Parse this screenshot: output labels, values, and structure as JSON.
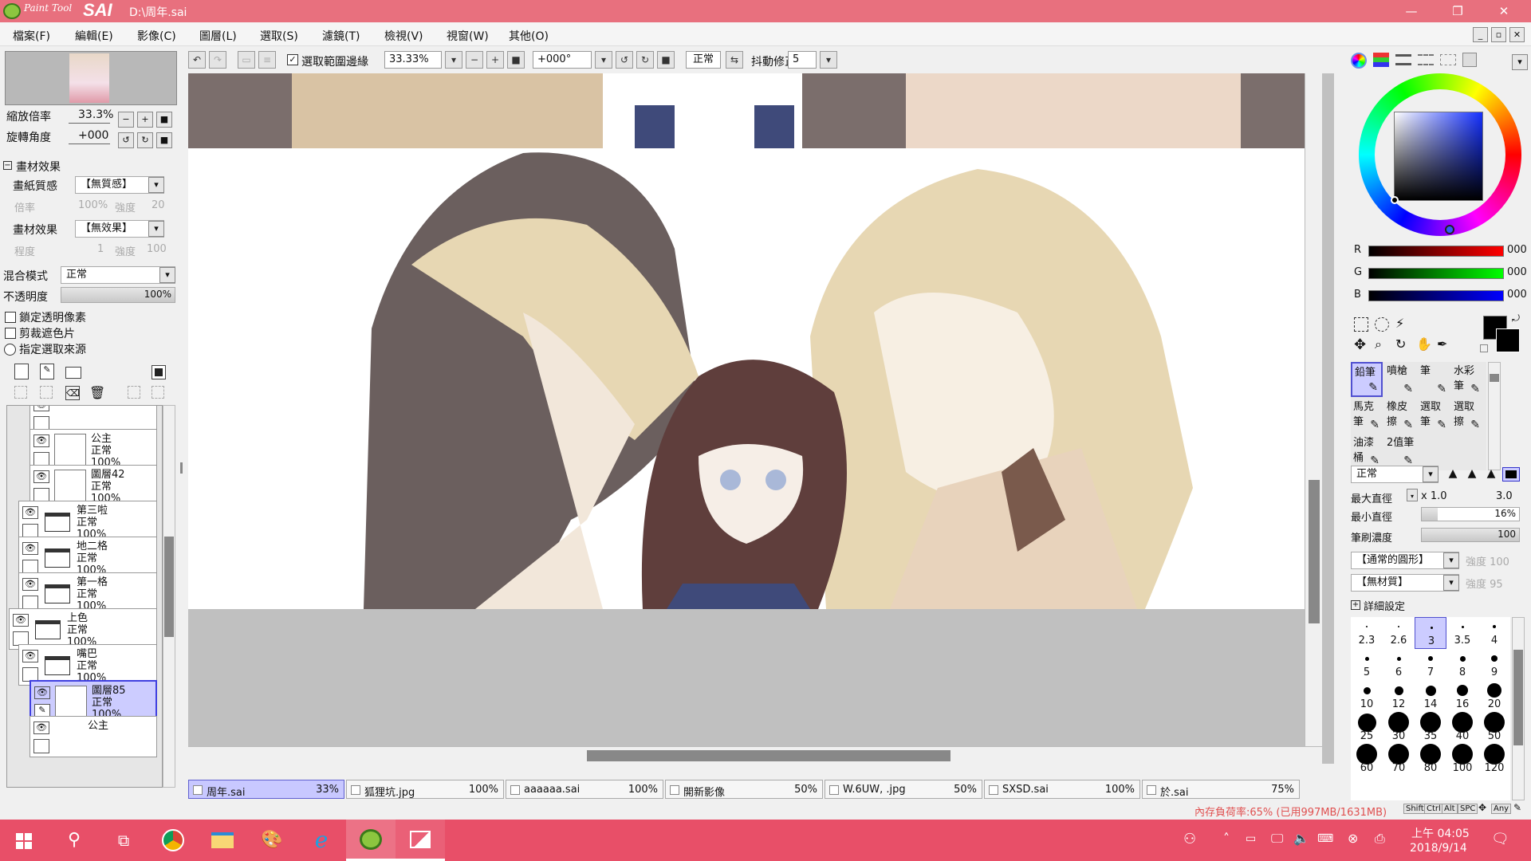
{
  "window": {
    "app_name_small": "Paint Tool",
    "app_name_big": "SAI",
    "title": "D:\\周年.sai"
  },
  "menu": [
    "檔案(F)",
    "編輯(E)",
    "影像(C)",
    "圖層(L)",
    "選取(S)",
    "濾鏡(T)",
    "檢視(V)",
    "視窗(W)",
    "其他(O)"
  ],
  "toolbar": {
    "select_edge_label": "選取範圍邊緣",
    "zoom_value": "33.33%",
    "rotation_value": "+000°",
    "mode_value": "正常",
    "stabilizer_label": "抖動修正",
    "stabilizer_value": "5"
  },
  "navigator": {
    "zoom_label": "縮放倍率",
    "zoom_value": "33.3%",
    "rotate_label": "旋轉角度",
    "rotate_value": "+000"
  },
  "paper": {
    "section": "畫材效果",
    "texture_label": "畫紙質感",
    "texture_value": "【無質感】",
    "tex_scale_label": "倍率",
    "tex_scale_value": "100%",
    "tex_strength_label": "強度",
    "tex_strength_value": "20",
    "effect_label": "畫材效果",
    "effect_value": "【無效果】",
    "eff_degree_label": "程度",
    "eff_degree_value": "1",
    "eff_strength_label": "強度",
    "eff_strength_value": "100"
  },
  "layer_props": {
    "blend_label": "混合模式",
    "blend_value": "正常",
    "opacity_label": "不透明度",
    "opacity_value": "100%",
    "opacity_level": 1.0,
    "lock_label": "鎖定透明像素",
    "clip_label": "剪裁遮色片",
    "source_label": "指定選取來源"
  },
  "layers": [
    {
      "name": "",
      "mode": "",
      "opacity": "100%",
      "type": "partial"
    },
    {
      "name": "公主",
      "mode": "正常",
      "opacity": "100%",
      "type": "layer"
    },
    {
      "name": "圖層42",
      "mode": "正常",
      "opacity": "100%",
      "type": "layer"
    },
    {
      "name": "第三啦",
      "mode": "正常",
      "opacity": "100%",
      "type": "folder"
    },
    {
      "name": "地二格",
      "mode": "正常",
      "opacity": "100%",
      "type": "folder"
    },
    {
      "name": "第一格",
      "mode": "正常",
      "opacity": "100%",
      "type": "folder"
    },
    {
      "name": "上色",
      "mode": "正常",
      "opacity": "100%",
      "type": "folder"
    },
    {
      "name": "嘴巴",
      "mode": "正常",
      "opacity": "100%",
      "type": "folder"
    },
    {
      "name": "圖層85",
      "mode": "正常",
      "opacity": "100%",
      "type": "layer-selected"
    },
    {
      "name": "公主",
      "mode": "",
      "opacity": "",
      "type": "partial"
    }
  ],
  "tabs": [
    {
      "name": "周年.sai",
      "pct": "33%",
      "active": true
    },
    {
      "name": "狐狸坑.jpg",
      "pct": "100%"
    },
    {
      "name": "aaaaaa.sai",
      "pct": "100%"
    },
    {
      "name": "開新影像",
      "pct": "50%"
    },
    {
      "name": "W.6UW, .jpg",
      "pct": "50%"
    },
    {
      "name": "SXSD.sai",
      "pct": "100%"
    },
    {
      "name": "於.sai",
      "pct": "75%"
    }
  ],
  "status": {
    "memory": "內存負荷率:65% (已用997MB/1631MB)",
    "keys": [
      "Shift",
      "Ctrl",
      "Alt",
      "SPC",
      "Any"
    ]
  },
  "color": {
    "r_label": "R",
    "r_value": "000",
    "g_label": "G",
    "g_value": "000",
    "b_label": "B",
    "b_value": "000",
    "fg": "#000000"
  },
  "brush_tools": [
    [
      "鉛筆",
      "噴槍",
      "筆",
      "水彩筆"
    ],
    [
      "馬克筆",
      "橡皮擦",
      "選取筆",
      "選取擦"
    ],
    [
      "油漆桶",
      "2值筆",
      "",
      ""
    ]
  ],
  "brush": {
    "mode_value": "正常",
    "max_label": "最大直徑",
    "max_mult": "x 1.0",
    "max_value": "3.0",
    "min_label": "最小直徑",
    "min_value": "16%",
    "min_level": 0.16,
    "density_label": "筆刷濃度",
    "density_value": "100",
    "density_level": 1.0,
    "shape_value": "【通常的圓形】",
    "shape_strength": "強度 100",
    "texture_value": "【無材質】",
    "texture_strength": "強度 95",
    "detail_label": "詳細設定"
  },
  "sizes": [
    [
      "2.3",
      "2.6",
      "3",
      "3.5",
      "4"
    ],
    [
      "5",
      "6",
      "7",
      "8",
      "9"
    ],
    [
      "10",
      "12",
      "14",
      "16",
      "20"
    ],
    [
      "25",
      "30",
      "35",
      "40",
      "50"
    ],
    [
      "60",
      "70",
      "80",
      "100",
      "120"
    ]
  ],
  "taskbar": {
    "time": "上午 04:05",
    "date": "2018/9/14"
  }
}
